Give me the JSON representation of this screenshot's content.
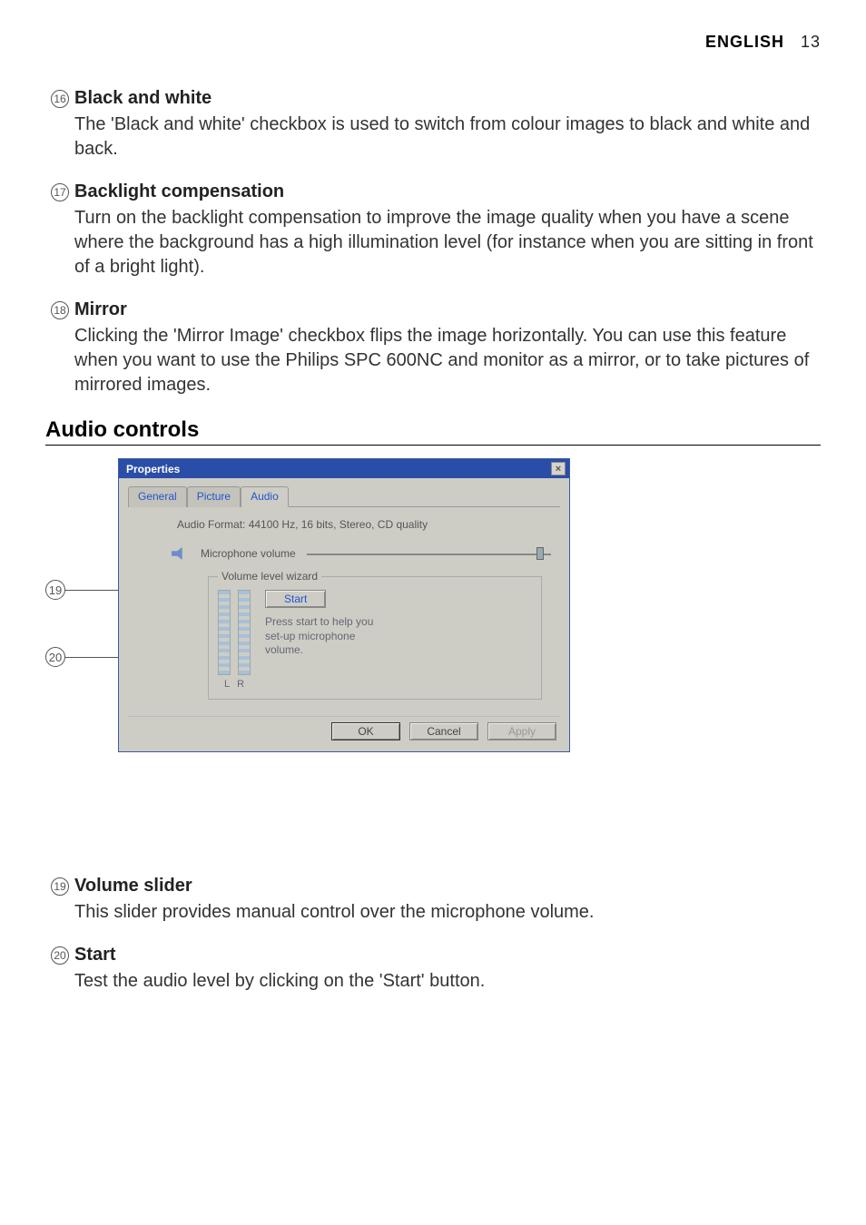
{
  "header": {
    "language": "ENGLISH",
    "page": "13"
  },
  "items": [
    {
      "num": "16",
      "title": "Black and white",
      "desc": "The 'Black and white' checkbox is used to switch from colour images to black and white and back."
    },
    {
      "num": "17",
      "title": "Backlight compensation",
      "desc": "Turn on the backlight compensation to improve the image quality when you have a scene where the background has a high illumination level (for instance when you are sitting in front of a bright light)."
    },
    {
      "num": "18",
      "title": "Mirror",
      "desc": "Clicking the 'Mirror Image' checkbox flips the image horizontally. You can use this feature when you want to use the Philips SPC 600NC and monitor as a mirror, or to take pictures of mirrored images."
    }
  ],
  "section_heading": "Audio controls",
  "dialog": {
    "title": "Properties",
    "tabs": {
      "general": "General",
      "picture": "Picture",
      "audio": "Audio"
    },
    "audio_format": "Audio Format: 44100 Hz, 16 bits, Stereo, CD quality",
    "mic_label": "Microphone volume",
    "wizard": {
      "legend": "Volume level wizard",
      "start": "Start",
      "hint": "Press start to help you set-up microphone volume.",
      "L": "L",
      "R": "R"
    },
    "buttons": {
      "ok": "OK",
      "cancel": "Cancel",
      "apply": "Apply"
    }
  },
  "callouts": {
    "c19": "19",
    "c20": "20"
  },
  "items2": [
    {
      "num": "19",
      "title": "Volume slider",
      "desc": "This slider provides manual control over the microphone volume."
    },
    {
      "num": "20",
      "title": "Start",
      "desc": "Test the audio level by clicking on the 'Start' button."
    }
  ]
}
